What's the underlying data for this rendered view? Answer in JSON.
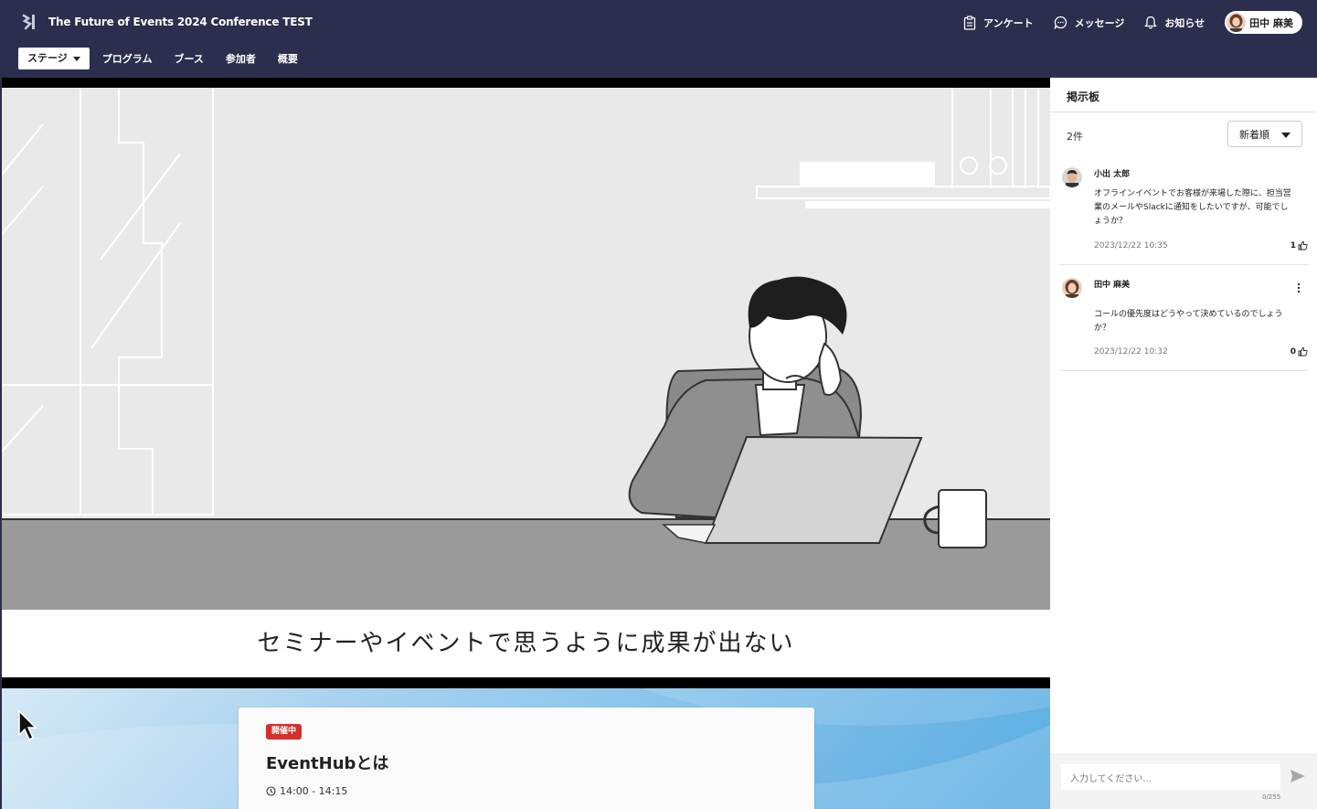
{
  "header": {
    "app_title": "The Future of Events 2024 Conference TEST",
    "actions": {
      "survey": "アンケート",
      "messages": "メッセージ",
      "notifications": "お知らせ"
    },
    "user": {
      "name": "田中 麻美"
    }
  },
  "nav": {
    "items": [
      {
        "label": "ステージ",
        "active": true
      },
      {
        "label": "プログラム"
      },
      {
        "label": "ブース"
      },
      {
        "label": "参加者"
      },
      {
        "label": "概要"
      }
    ]
  },
  "stage": {
    "slide_caption": "セミナーやイベントで思うように成果が出ない"
  },
  "session": {
    "status_badge": "開催中",
    "title": "EventHubとは",
    "time": "14:00 - 14:15"
  },
  "board": {
    "title": "掲示板",
    "count": "2件",
    "sort": {
      "selected": "新着順"
    },
    "posts": [
      {
        "author": "小出 太郎",
        "body": "オフラインイベントでお客様が来場した際に、担当営業のメールやSlackに通知をしたいですが、可能でしょうか？",
        "time": "2023/12/22 10:35",
        "likes": "1"
      },
      {
        "author": "田中 麻美",
        "body": "コールの優先度はどうやって決めているのでしょうか？",
        "time": "2023/12/22 10:32",
        "likes": "0"
      }
    ],
    "composer": {
      "placeholder": "入力してください...",
      "counter": "0/255"
    }
  },
  "colors": {
    "header_bg": "#2b2e4c",
    "badge_red": "#d0312d"
  }
}
